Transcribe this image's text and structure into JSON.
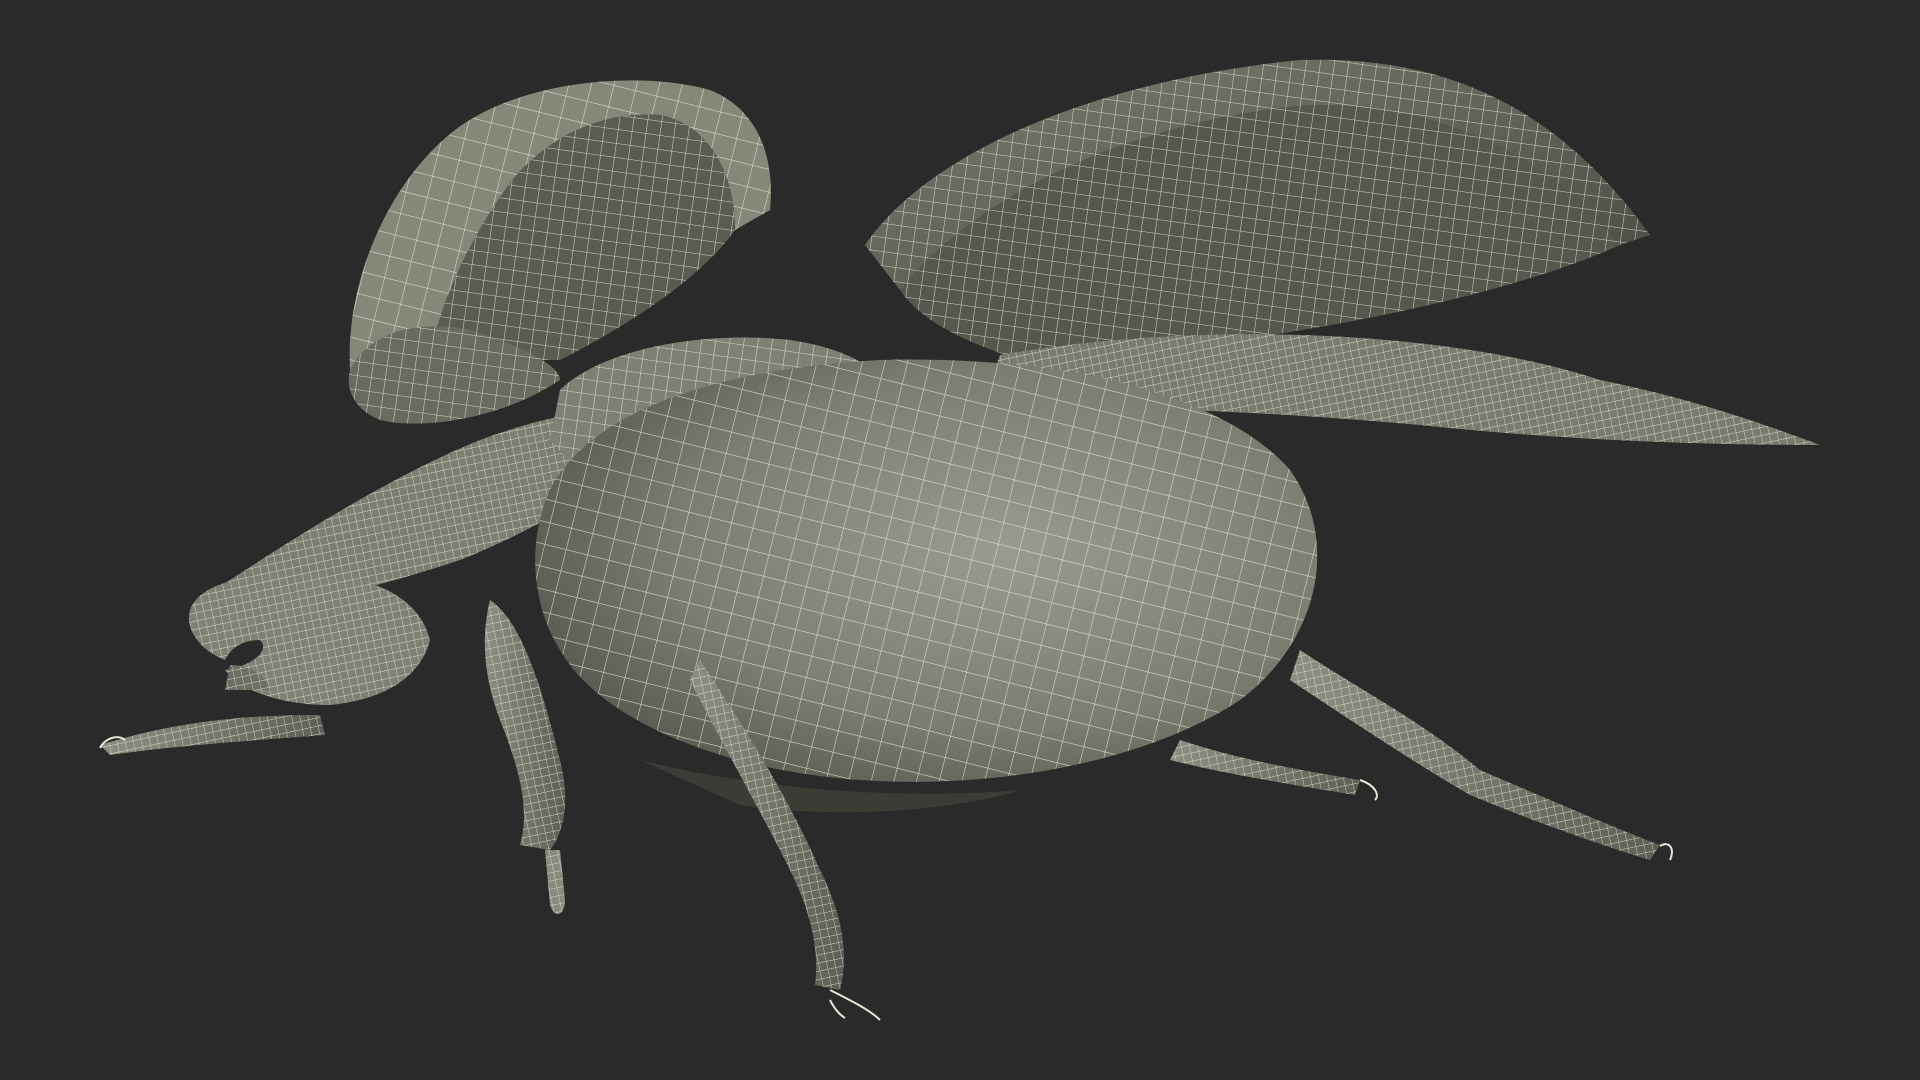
{
  "scene": {
    "background_color": "#2a2a2a",
    "mesh_fill_light": "#8a8b7e",
    "mesh_fill_dark": "#55564d",
    "wire_color": "#e8e6d6"
  }
}
